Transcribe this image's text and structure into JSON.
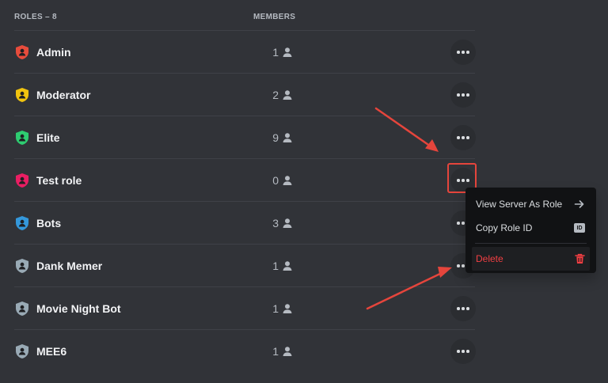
{
  "header": {
    "roles_label": "ROLES – 8",
    "members_label": "MEMBERS"
  },
  "roles": [
    {
      "name": "Admin",
      "count": "1",
      "color": "#e74c3c"
    },
    {
      "name": "Moderator",
      "count": "2",
      "color": "#f1c40f"
    },
    {
      "name": "Elite",
      "count": "9",
      "color": "#2ecc71"
    },
    {
      "name": "Test role",
      "count": "0",
      "color": "#e91e63"
    },
    {
      "name": "Bots",
      "count": "3",
      "color": "#3498db"
    },
    {
      "name": "Dank Memer",
      "count": "1",
      "color": "#99aab5"
    },
    {
      "name": "Movie Night Bot",
      "count": "1",
      "color": "#99aab5"
    },
    {
      "name": "MEE6",
      "count": "1",
      "color": "#99aab5"
    }
  ],
  "context_menu": {
    "view_as_role": "View Server As Role",
    "copy_role_id": "Copy Role ID",
    "id_badge": "ID",
    "delete": "Delete"
  },
  "colors": {
    "annotation_red": "#e5453c",
    "danger": "#f23f43"
  }
}
